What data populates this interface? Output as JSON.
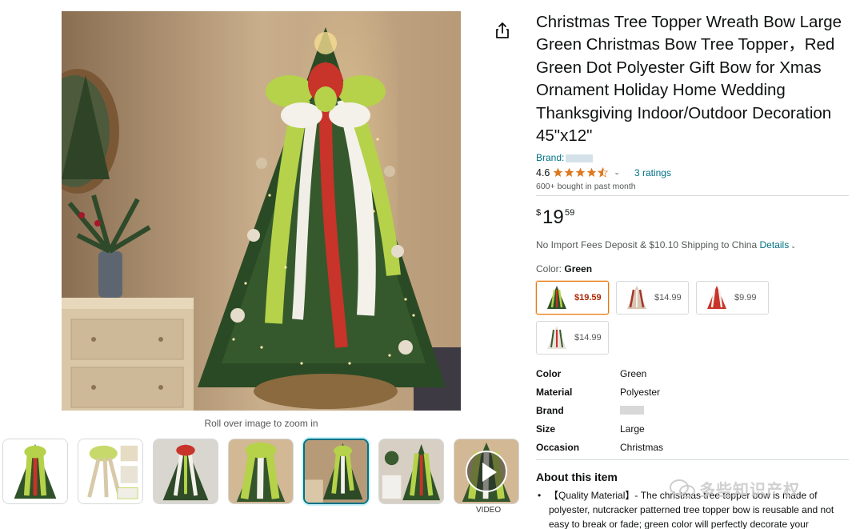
{
  "product": {
    "title": "Christmas Tree Topper Wreath Bow Large Green Christmas Bow Tree Topper，Red Green Dot Polyester Gift Bow for Xmas Ornament Holiday Home Wedding Thanksgiving Indoor/Outdoor Decoration 45\"x12\"",
    "brand_label": "Brand:",
    "rating_value": "4.6",
    "ratings_count": "3 ratings",
    "bought_text": "600+ bought in past month",
    "price": {
      "symbol": "$",
      "whole": "19",
      "fraction": "59"
    },
    "shipping_text": "No Import Fees Deposit & $10.10 Shipping to China",
    "shipping_details_link": "Details",
    "color_label": "Color:",
    "color_selected": "Green",
    "zoom_hint": "Roll over image to zoom in",
    "video_label": "VIDEO"
  },
  "swatches": [
    {
      "price": "$19.59",
      "selected": true
    },
    {
      "price": "$14.99",
      "selected": false
    },
    {
      "price": "$9.99",
      "selected": false
    },
    {
      "price": "$14.99",
      "selected": false
    }
  ],
  "specs": [
    {
      "key": "Color",
      "value": "Green"
    },
    {
      "key": "Material",
      "value": "Polyester"
    },
    {
      "key": "Brand",
      "value": ""
    },
    {
      "key": "Size",
      "value": "Large"
    },
    {
      "key": "Occasion",
      "value": "Christmas"
    }
  ],
  "about": {
    "title": "About this item",
    "bullet_1": "【Quality Material】- The christmas tree topper bow is made of polyester, nutcracker patterned tree topper bow is reusable and not easy to break or fade; green color will perfectly decorate your"
  },
  "watermark_text": "多些知识产权",
  "colors": {
    "link": "#007185",
    "price_red": "#b12704",
    "selected_border": "#e47911",
    "star": "#de7921"
  },
  "icons": {
    "share": "share-icon",
    "star": "star-icon",
    "play": "play-icon"
  }
}
